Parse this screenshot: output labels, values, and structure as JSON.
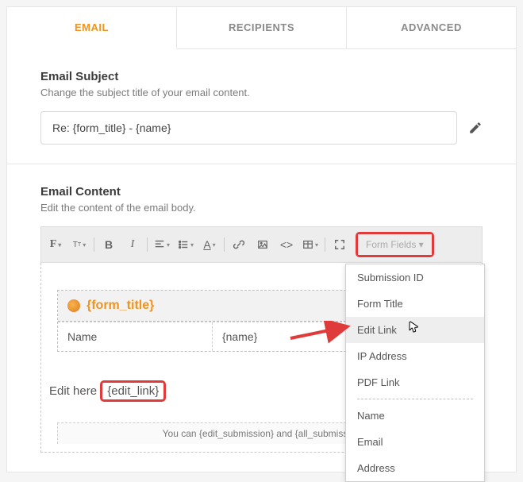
{
  "tabs": {
    "email": "EMAIL",
    "recipients": "RECIPIENTS",
    "advanced": "ADVANCED"
  },
  "subject": {
    "title": "Email Subject",
    "desc": "Change the subject title of your email content.",
    "value": "Re: {form_title} - {name}"
  },
  "content": {
    "title": "Email Content",
    "desc": "Edit the content of the email body.",
    "form_fields_btn": "Form Fields ▾",
    "form_title_token": "{form_title}",
    "row_name_label": "Name",
    "row_name_value": "{name}",
    "edit_here_prefix": "Edit here ",
    "edit_link_token": "{edit_link}",
    "footer": "You can {edit_submission} and {all_submission"
  },
  "dropdown": {
    "items": [
      "Submission ID",
      "Form Title",
      "Edit Link",
      "IP Address",
      "PDF Link"
    ],
    "items2": [
      "Name",
      "Email",
      "Address"
    ]
  }
}
